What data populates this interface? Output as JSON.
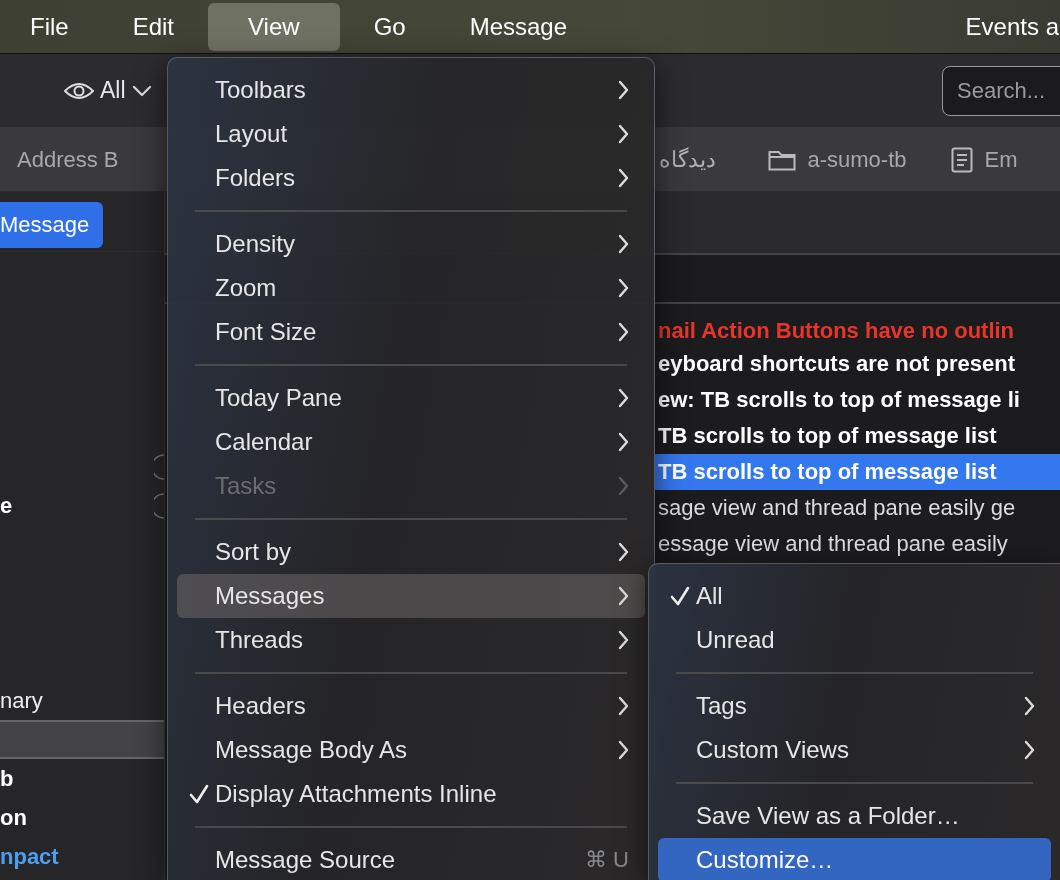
{
  "menubar": {
    "items": [
      {
        "label": "File",
        "selected": false
      },
      {
        "label": "Edit",
        "selected": false
      },
      {
        "label": "View",
        "selected": true
      },
      {
        "label": "Go",
        "selected": false
      },
      {
        "label": "Message",
        "selected": false
      }
    ],
    "right_label": "Events a"
  },
  "toolbar": {
    "view_filter": {
      "label": "All"
    },
    "search": {
      "placeholder": "Search..."
    }
  },
  "tabs": [
    {
      "label": "Address B",
      "kind": "plain"
    },
    {
      "label": "دیدگاه",
      "kind": "plain"
    },
    {
      "label": "a-sumo-tb",
      "kind": "folder"
    },
    {
      "label": "Em",
      "kind": "document"
    }
  ],
  "folder_pane": {
    "new_message_button": "Message",
    "items": [
      {
        "label": "e",
        "unread": true,
        "selected": false
      },
      {
        "label": "nary",
        "unread": false,
        "selected": false
      },
      {
        "unread": false,
        "selected": true
      },
      {
        "label": "b",
        "unread": true,
        "selected": false
      },
      {
        "label": "on",
        "unread": true,
        "selected": false
      },
      {
        "label": "npact",
        "unread": true,
        "selected": false,
        "color": "#4d9ff0"
      }
    ]
  },
  "thread_list": {
    "rows": [
      {
        "subject": "nail Action Buttons have no outlin",
        "unread": true,
        "selected": false,
        "color": "#e8352b"
      },
      {
        "subject": "eyboard shortcuts are not present",
        "unread": true,
        "selected": false
      },
      {
        "subject": "ew: TB scrolls to top of message li",
        "unread": true,
        "selected": false
      },
      {
        "subject": "TB scrolls to top of message list",
        "unread": true,
        "selected": false
      },
      {
        "subject": "TB scrolls to top of message list",
        "unread": true,
        "selected": true
      },
      {
        "subject": "sage view and thread pane easily ge",
        "unread": false,
        "selected": false
      },
      {
        "subject": "essage view and thread pane easily",
        "unread": false,
        "selected": false
      }
    ]
  },
  "view_menu": {
    "groups": [
      {
        "items": [
          {
            "label": "Toolbars",
            "submenu": true,
            "selected": false
          },
          {
            "label": "Layout",
            "submenu": true,
            "selected": false
          },
          {
            "label": "Folders",
            "submenu": true,
            "selected": false
          }
        ]
      },
      {
        "items": [
          {
            "label": "Density",
            "submenu": true,
            "selected": false
          },
          {
            "label": "Zoom",
            "submenu": true,
            "selected": false
          },
          {
            "label": "Font Size",
            "submenu": true,
            "selected": false
          }
        ]
      },
      {
        "items": [
          {
            "label": "Today Pane",
            "submenu": true,
            "selected": false
          },
          {
            "label": "Calendar",
            "submenu": true,
            "selected": false
          },
          {
            "label": "Tasks",
            "submenu": true,
            "selected": false,
            "disabled": true
          }
        ]
      },
      {
        "items": [
          {
            "label": "Sort by",
            "submenu": true,
            "selected": false
          },
          {
            "label": "Messages",
            "submenu": true,
            "selected": true
          },
          {
            "label": "Threads",
            "submenu": true,
            "selected": false
          }
        ]
      },
      {
        "items": [
          {
            "label": "Headers",
            "submenu": true,
            "selected": false
          },
          {
            "label": "Message Body As",
            "submenu": true,
            "selected": false
          },
          {
            "label": "Display Attachments Inline",
            "submenu": false,
            "selected": false,
            "checked": true
          }
        ]
      },
      {
        "items": [
          {
            "label": "Message Source",
            "submenu": false,
            "selected": false,
            "shortcut": "⌘ U"
          }
        ]
      }
    ]
  },
  "messages_submenu": {
    "groups": [
      {
        "items": [
          {
            "label": "All",
            "submenu": false,
            "selected": false,
            "checked": true
          },
          {
            "label": "Unread",
            "submenu": false,
            "selected": false,
            "checked": false
          }
        ]
      },
      {
        "items": [
          {
            "label": "Tags",
            "submenu": true,
            "selected": false
          },
          {
            "label": "Custom Views",
            "submenu": true,
            "selected": false
          }
        ]
      },
      {
        "items": [
          {
            "label": "Save View as a Folder…",
            "submenu": false,
            "selected": false
          },
          {
            "label": "Customize…",
            "submenu": false,
            "selected": true,
            "accent": true
          }
        ]
      }
    ]
  }
}
